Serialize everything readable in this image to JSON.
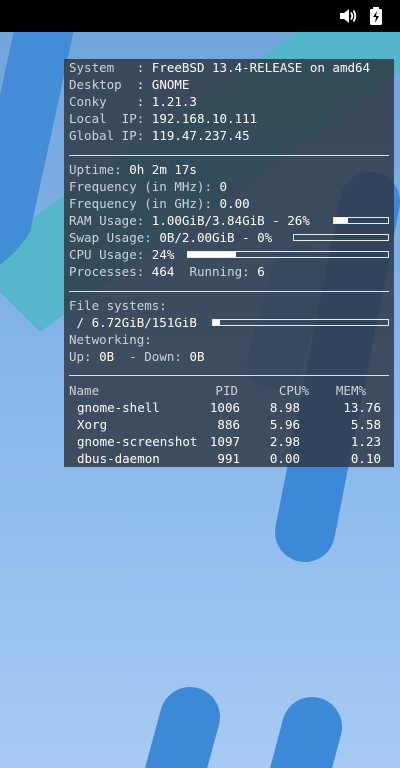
{
  "conky": {
    "system_label": "System",
    "system_value": "FreeBSD 13.4-RELEASE on amd64",
    "desktop_label": "Desktop",
    "desktop_value": "GNOME",
    "conky_label": "Conky",
    "conky_value": "1.21.3",
    "local_ip_label": "Local  IP:",
    "local_ip_value": "192.168.10.111",
    "global_ip_label": "Global IP:",
    "global_ip_value": "119.47.237.45",
    "uptime_label": "Uptime:",
    "uptime_value": "0h 2m 17s",
    "freq_mhz_label": "Frequency (in MHz):",
    "freq_mhz_value": "0",
    "freq_ghz_label": "Frequency (in GHz):",
    "freq_ghz_value": "0.00",
    "ram_label": "RAM Usage:",
    "ram_value": "1.00GiB/3.84GiB - 26%",
    "ram_pct": 26,
    "swap_label": "Swap Usage:",
    "swap_value": "0B/2.00GiB - 0%",
    "swap_pct": 0,
    "cpu_label": "CPU Usage:",
    "cpu_value": "24%",
    "cpu_pct": 24,
    "processes_label": "Processes:",
    "processes_value": "464",
    "running_label": "Running:",
    "running_value": "6",
    "fs_label": "File systems:",
    "fs_root": " / ",
    "fs_value": "6.72GiB/151GiB",
    "fs_pct": 4,
    "net_label": "Networking:",
    "up_label": "Up:",
    "up_value": "0B",
    "down_label": " - Down:",
    "down_value": "0B",
    "table": {
      "headers": [
        "Name",
        "PID",
        "CPU%",
        "MEM%"
      ],
      "rows": [
        [
          "gnome-shell",
          "1006",
          "8.98",
          "13.76"
        ],
        [
          "Xorg",
          "886",
          "5.96",
          "5.58"
        ],
        [
          "gnome-screenshot",
          "1097",
          "2.98",
          "1.23"
        ],
        [
          "dbus-daemon",
          "991",
          "0.00",
          "0.10"
        ]
      ]
    }
  },
  "icons": {
    "volume": "speaker-icon",
    "battery": "battery-charging-icon"
  }
}
